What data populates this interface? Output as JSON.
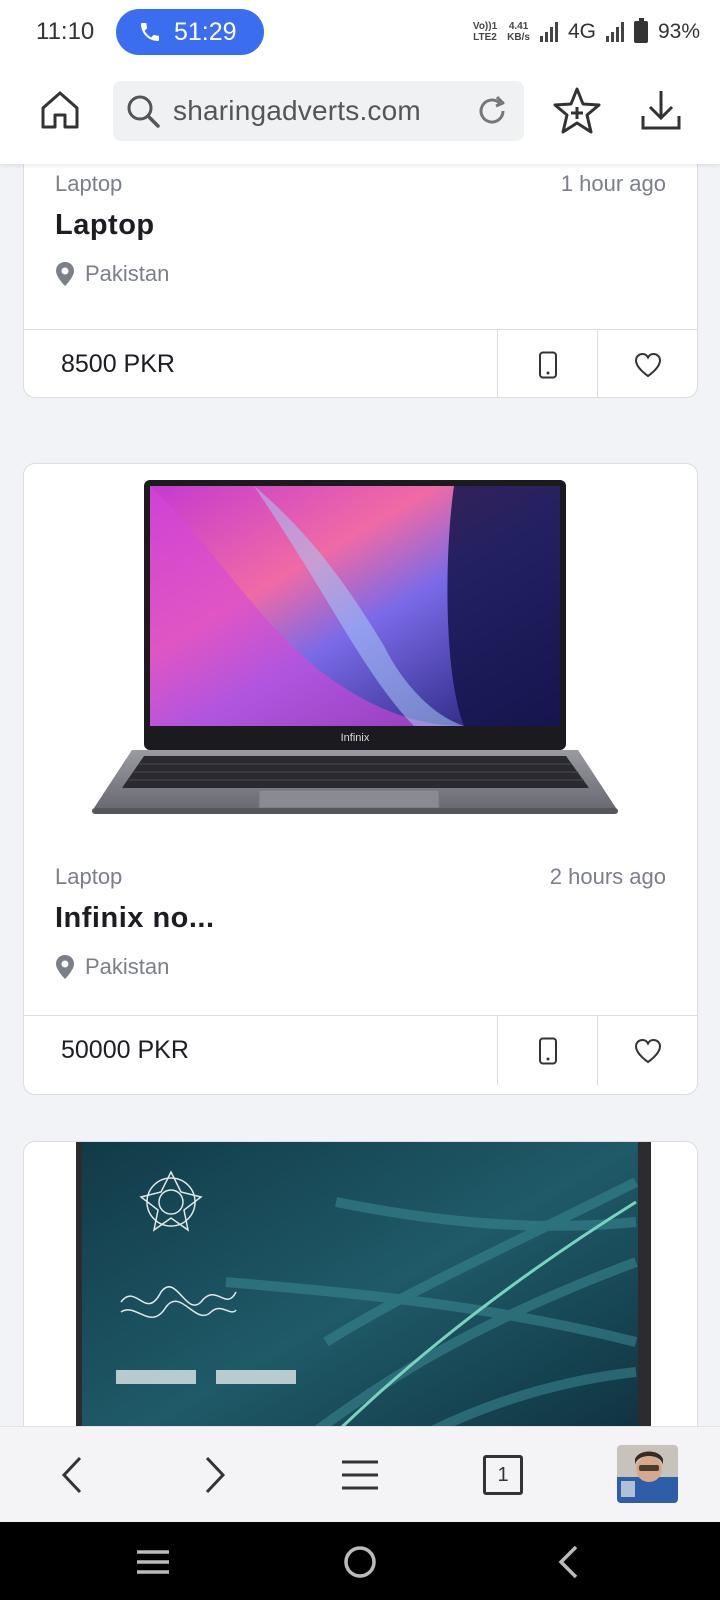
{
  "status": {
    "time": "11:10",
    "call_duration": "51:29",
    "volte_top": "Vo))1",
    "volte_bottom": "LTE2",
    "net_speed_top": "4.41",
    "net_speed_bottom": "KB/s",
    "network": "4G",
    "battery": "93%"
  },
  "browser": {
    "url": "sharingadverts.com"
  },
  "listings": [
    {
      "category": "Laptop",
      "time": "1 hour ago",
      "title": "Laptop",
      "location": "Pakistan",
      "price": "8500 PKR"
    },
    {
      "category": "Laptop",
      "time": "2 hours ago",
      "title": "Infinix no...",
      "location": "Pakistan",
      "price": "50000 PKR",
      "image_brand": "Infinix"
    }
  ],
  "toolbar": {
    "tab_count": "1"
  },
  "colors": {
    "accent": "#3b6df0",
    "card_border": "#dcdde3",
    "page_bg": "#f2f3f7"
  }
}
